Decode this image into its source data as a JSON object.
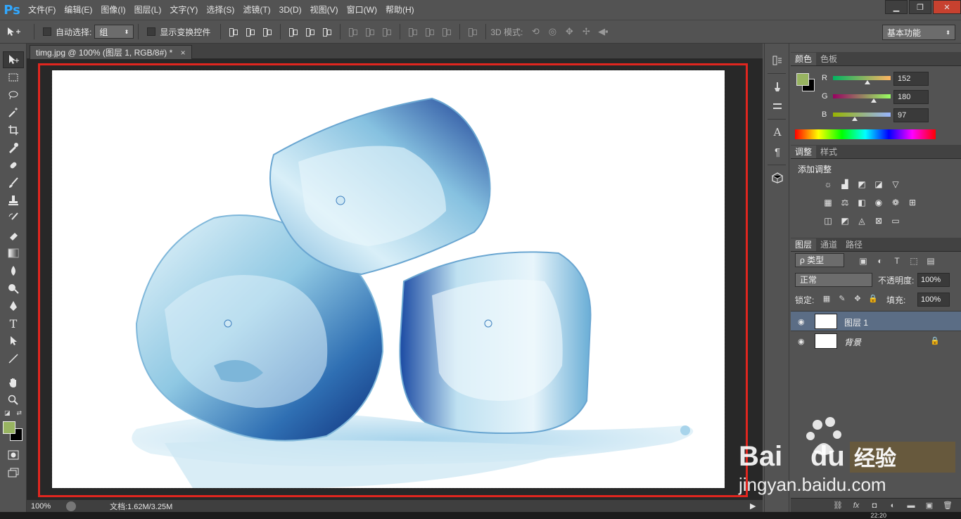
{
  "app": {
    "logo": "Ps"
  },
  "menu": [
    "文件(F)",
    "编辑(E)",
    "图像(I)",
    "图层(L)",
    "文字(Y)",
    "选择(S)",
    "滤镜(T)",
    "3D(D)",
    "视图(V)",
    "窗口(W)",
    "帮助(H)"
  ],
  "window_controls": {
    "minimize": "▁",
    "restore": "❐",
    "close": "✕"
  },
  "options": {
    "auto_select_label": "自动选择:",
    "auto_select_value": "组",
    "show_transform_label": "显示变换控件",
    "mode_3d_label": "3D 模式:",
    "workspace": "基本功能"
  },
  "document": {
    "tab_title": "timg.jpg @ 100% (图层 1, RGB/8#) *",
    "tab_close": "×"
  },
  "status": {
    "zoom": "100%",
    "doc_info": "文档:1.62M/3.25M",
    "arrow": "▶"
  },
  "taskbar": {
    "clock": "22:20"
  },
  "colors": {
    "foreground": "#98b461",
    "background": "#000000",
    "selection_frame": "#e0261f",
    "layer_selected": "#5b6d85"
  },
  "color_panel": {
    "tabs": [
      "颜色",
      "色板"
    ],
    "r_label": "R",
    "g_label": "G",
    "b_label": "B",
    "r": "152",
    "g": "180",
    "b": "97",
    "r_level": 0.596,
    "g_level": 0.706,
    "b_level": 0.38
  },
  "adjust_panel": {
    "tabs": [
      "调整",
      "样式"
    ],
    "title": "添加调整"
  },
  "layers_panel": {
    "tabs": [
      "图层",
      "通道",
      "路径"
    ],
    "filter": "ρ 类型",
    "blend_mode": "正常",
    "opacity_label": "不透明度:",
    "opacity": "100%",
    "lock_label": "锁定:",
    "fill_label": "填充:",
    "fill": "100%",
    "layers": [
      {
        "name": "图层 1",
        "selected": true
      },
      {
        "name": "背景",
        "selected": false
      }
    ]
  },
  "watermark": {
    "brand": "Bai",
    "brand2": "du",
    "cn": "经验",
    "url": "jingyan.baidu.com"
  }
}
